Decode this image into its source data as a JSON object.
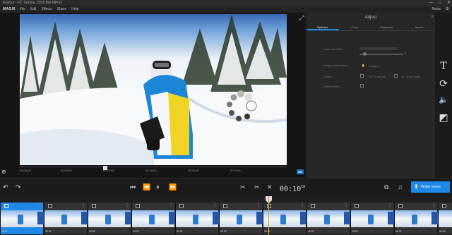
{
  "window": {
    "title": "Fastcut - FC Tutorial_2019 Ber MPG2",
    "controls": [
      "—",
      "□",
      "✕"
    ]
  },
  "menubar": {
    "logo": "MAGIX",
    "items": [
      "File",
      "Edit",
      "Effects",
      "Share",
      "Help"
    ],
    "news": "News"
  },
  "preview": {
    "ruler_ticks": [
      "00:00:00",
      "00:05:00",
      "00:10:00",
      "00:15:00",
      "00:20:00",
      "00:25:00"
    ],
    "hd_badge": "HD"
  },
  "adjust": {
    "title": "Adjust",
    "tabs": [
      "Optimize",
      "Color",
      "Sharpness",
      "Speed"
    ],
    "active_tab": "Optimize",
    "lens_correction": {
      "label": "Lens correction",
      "select_value": "",
      "value": "0"
    },
    "image_stabilization": {
      "label": "Image stabilization",
      "button": "Analyze"
    },
    "rotate": {
      "label": "Rotate",
      "left": "90° to the left",
      "right": "90° to the right"
    },
    "reset": {
      "label": "Switch effect"
    }
  },
  "tools": [
    "T",
    "⟳",
    "🔈",
    "◩"
  ],
  "transport": {
    "timecode_main": "00:10",
    "timecode_frames": "18",
    "finish_label": "Finish movie"
  },
  "timeline": {
    "clips": [
      {
        "label": "00:01",
        "selected": true
      },
      {
        "label": "00:01",
        "selected": false
      },
      {
        "label": "00:02",
        "selected": false
      },
      {
        "label": "00:02",
        "selected": false
      },
      {
        "label": "00:01",
        "selected": false
      },
      {
        "label": "00:03",
        "selected": false
      },
      {
        "label": "00:02",
        "selected": false
      },
      {
        "label": "00:01",
        "selected": false
      },
      {
        "label": "00:00",
        "selected": false
      },
      {
        "label": "00:01",
        "selected": false
      },
      {
        "label": "00:00",
        "selected": false
      }
    ]
  }
}
